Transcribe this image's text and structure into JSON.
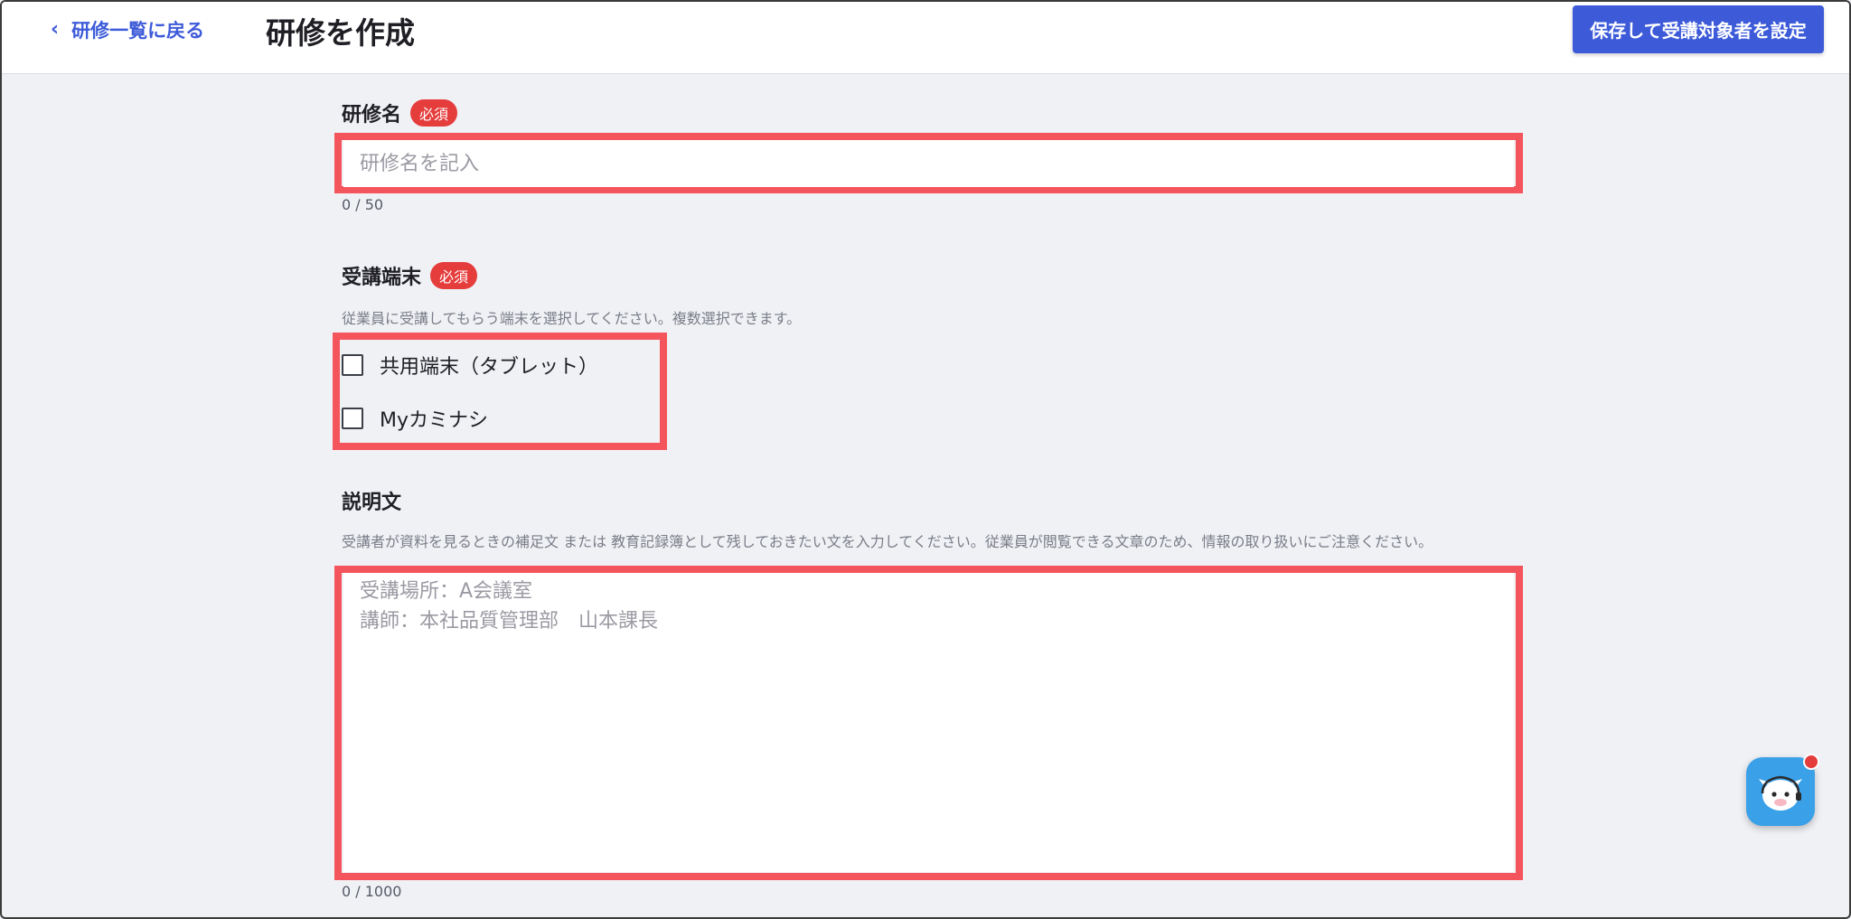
{
  "header": {
    "back_label": "研修一覧に戻る",
    "title": "研修を作成",
    "save_button": "保存して受講対象者を設定"
  },
  "fields": {
    "name": {
      "label": "研修名",
      "required_badge": "必須",
      "placeholder": "研修名を記入",
      "value": "",
      "counter": "0 / 50"
    },
    "devices": {
      "label": "受講端末",
      "required_badge": "必須",
      "hint": "従業員に受講してもらう端末を選択してください。複数選択できます。",
      "options": [
        {
          "label": "共用端末（タブレット）",
          "checked": false
        },
        {
          "label": "Myカミナシ",
          "checked": false
        }
      ]
    },
    "description": {
      "label": "説明文",
      "hint": "受講者が資料を見るときの補足文 または 教育記録簿として残しておきたい文を入力してください。従業員が閲覧できる文章のため、情報の取り扱いにご注意ください。",
      "placeholder": "受講場所：A会議室\n講師：本社品質管理部　山本課長",
      "value": "",
      "counter": "0 / 1000"
    }
  },
  "colors": {
    "primary": "#3d5bd9",
    "required": "#e53c3c",
    "highlight": "#f4545b",
    "chat": "#3aa0e8"
  },
  "icons": {
    "back": "chevron-left-icon",
    "chat": "support-mascot-icon"
  }
}
